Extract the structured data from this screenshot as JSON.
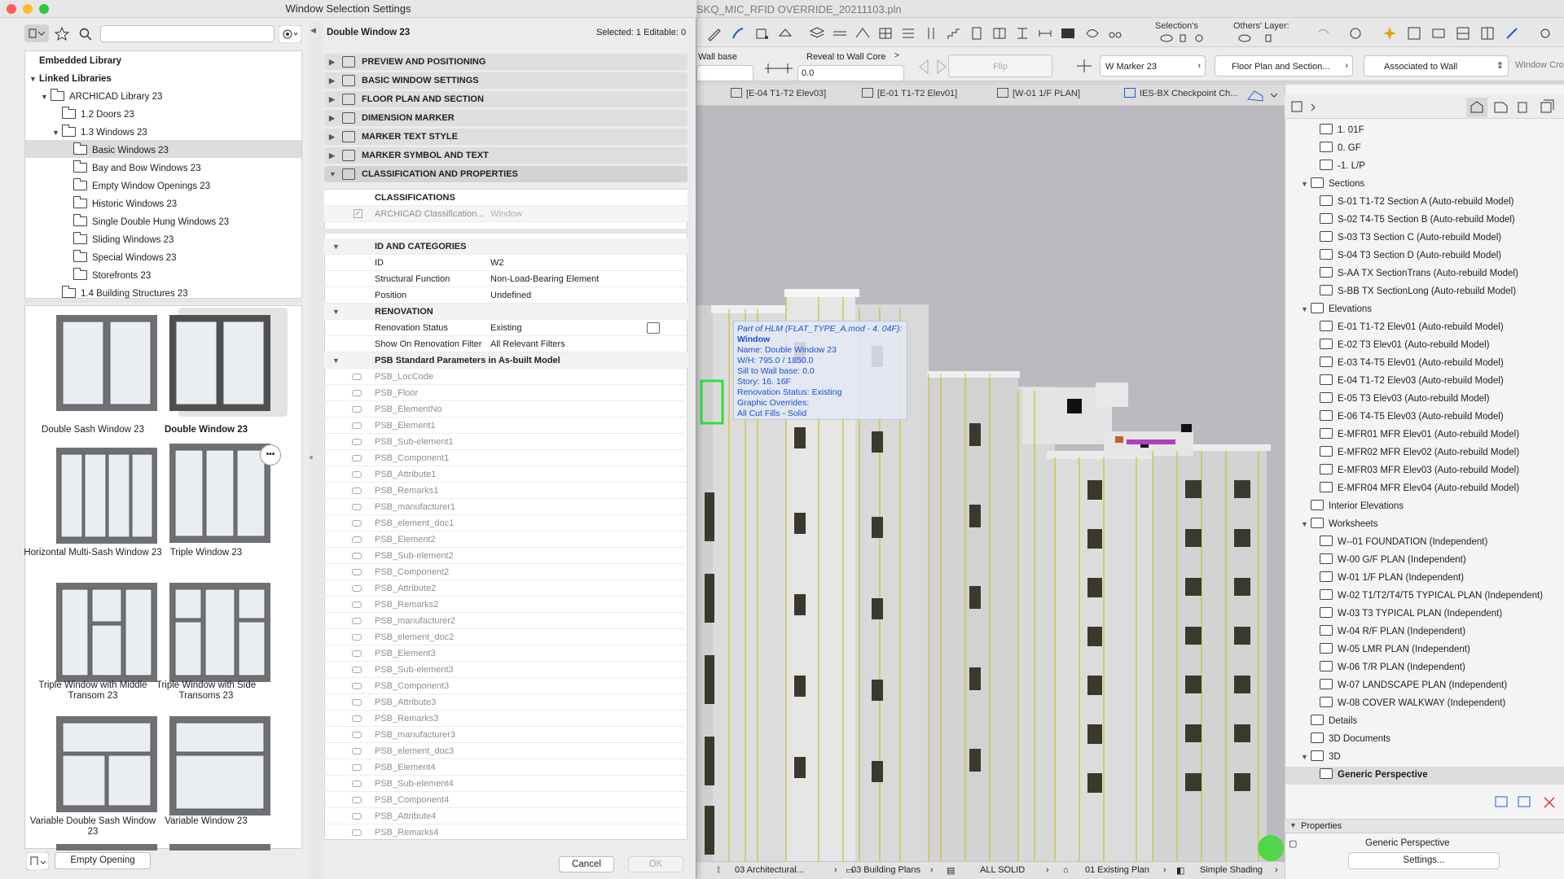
{
  "app": {
    "title": "SKQ_MIC_RFID OVERRIDE_20211103.pln",
    "selections_label": "Selection's",
    "others_layer_label": "Others' Layer:",
    "info": {
      "wall_base_label": "Wall base",
      "reveal_label": "Reveal to Wall Core",
      "reveal_value": "0.0",
      "flip_label": "Flip",
      "marker_value": "W Marker 23",
      "floorplan_value": "Floor Plan and Section...",
      "associated_value": "Associated to Wall",
      "window_cr_label": "Window Cro"
    },
    "tabs": [
      "[E-04 T1-T2 Elev03]",
      "[E-01 T1-T2 Elev01]",
      "[W-01 1/F PLAN]",
      "IES-BX Checkpoint Ch..."
    ],
    "status": {
      "layer_combo": "03 Architectural...",
      "model_view": "03 Building Plans",
      "pen_set": "ALL SOLID",
      "renovation": "01 Existing Plan",
      "shading": "Simple Shading"
    }
  },
  "tooltip": {
    "header": "Part of HLM (FLAT_TYPE_A.mod - 4. 04F):",
    "type": "Window",
    "lines": [
      "Name: Double Window 23",
      "W/H: 795.0 / 1850.0",
      "Sill to Wall base: 0.0",
      "Story: 16. 16F",
      "Renovation Status: Existing",
      "Graphic Overrides:",
      "All Cut Fills - Solid"
    ]
  },
  "navigator": {
    "rows": [
      {
        "label": "1. 01F",
        "level": 2
      },
      {
        "label": "0. GF",
        "level": 2
      },
      {
        "label": "-1. L/P",
        "level": 2
      },
      {
        "label": "Sections",
        "level": 1,
        "open": true
      },
      {
        "label": "S-01 T1-T2 Section A (Auto-rebuild Model)",
        "level": 2
      },
      {
        "label": "S-02 T4-T5 Section B (Auto-rebuild Model)",
        "level": 2
      },
      {
        "label": "S-03 T3 Section C (Auto-rebuild Model)",
        "level": 2
      },
      {
        "label": "S-04 T3 Section D (Auto-rebuild Model)",
        "level": 2
      },
      {
        "label": "S-AA TX SectionTrans (Auto-rebuild Model)",
        "level": 2
      },
      {
        "label": "S-BB TX SectionLong (Auto-rebuild Model)",
        "level": 2
      },
      {
        "label": "Elevations",
        "level": 1,
        "open": true
      },
      {
        "label": "E-01 T1-T2 Elev01 (Auto-rebuild Model)",
        "level": 2
      },
      {
        "label": "E-02 T3 Elev01 (Auto-rebuild Model)",
        "level": 2
      },
      {
        "label": "E-03 T4-T5 Elev01 (Auto-rebuild Model)",
        "level": 2
      },
      {
        "label": "E-04 T1-T2 Elev03 (Auto-rebuild Model)",
        "level": 2
      },
      {
        "label": "E-05 T3 Elev03 (Auto-rebuild Model)",
        "level": 2
      },
      {
        "label": "E-06 T4-T5 Elev03 (Auto-rebuild Model)",
        "level": 2
      },
      {
        "label": "E-MFR01 MFR Elev01 (Auto-rebuild Model)",
        "level": 2
      },
      {
        "label": "E-MFR02 MFR Elev02 (Auto-rebuild Model)",
        "level": 2
      },
      {
        "label": "E-MFR03 MFR Elev03 (Auto-rebuild Model)",
        "level": 2
      },
      {
        "label": "E-MFR04 MFR Elev04 (Auto-rebuild Model)",
        "level": 2
      },
      {
        "label": "Interior Elevations",
        "level": 1
      },
      {
        "label": "Worksheets",
        "level": 1,
        "open": true
      },
      {
        "label": "W--01 FOUNDATION (Independent)",
        "level": 2
      },
      {
        "label": "W-00 G/F PLAN (Independent)",
        "level": 2
      },
      {
        "label": "W-01 1/F PLAN (Independent)",
        "level": 2
      },
      {
        "label": "W-02 T1/T2/T4/T5 TYPICAL PLAN (Independent)",
        "level": 2
      },
      {
        "label": "W-03 T3 TYPICAL PLAN (Independent)",
        "level": 2
      },
      {
        "label": "W-04 R/F PLAN (Independent)",
        "level": 2
      },
      {
        "label": "W-05 LMR PLAN (Independent)",
        "level": 2
      },
      {
        "label": "W-06 T/R PLAN (Independent)",
        "level": 2
      },
      {
        "label": "W-07 LANDSCAPE PLAN (Independent)",
        "level": 2
      },
      {
        "label": "W-08 COVER WALKWAY (Independent)",
        "level": 2
      },
      {
        "label": "Details",
        "level": 1
      },
      {
        "label": "3D Documents",
        "level": 1
      },
      {
        "label": "3D",
        "level": 1,
        "open": true
      },
      {
        "label": "Generic Perspective",
        "level": 2,
        "selected": true
      }
    ],
    "properties_label": "Properties",
    "properties_value": "Generic Perspective",
    "settings_button": "Settings..."
  },
  "dialog": {
    "title": "Window Selection Settings",
    "tree": [
      {
        "label": "Embedded Library",
        "level": 0,
        "bold": true
      },
      {
        "label": "Linked Libraries",
        "level": 0,
        "bold": true,
        "open": true
      },
      {
        "label": "ARCHICAD Library 23",
        "level": 1,
        "open": true
      },
      {
        "label": "1.2 Doors 23",
        "level": 2
      },
      {
        "label": "1.3 Windows 23",
        "level": 2,
        "open": true
      },
      {
        "label": "Basic Windows 23",
        "level": 3,
        "selected": true
      },
      {
        "label": "Bay and Bow Windows 23",
        "level": 3
      },
      {
        "label": "Empty Window Openings 23",
        "level": 3
      },
      {
        "label": "Historic Windows 23",
        "level": 3
      },
      {
        "label": "Single Double Hung Windows 23",
        "level": 3
      },
      {
        "label": "Sliding Windows 23",
        "level": 3
      },
      {
        "label": "Special Windows 23",
        "level": 3
      },
      {
        "label": "Storefronts 23",
        "level": 3
      },
      {
        "label": "1.4 Building Structures 23",
        "level": 2
      }
    ],
    "windows": [
      {
        "label": "Double Sash Window 23",
        "kind": "double"
      },
      {
        "label": "Double Window 23",
        "kind": "double-dark",
        "selected": true
      },
      {
        "label": "Horizontal Multi-Sash Window 23",
        "kind": "multi"
      },
      {
        "label": "Triple Window 23",
        "kind": "triple"
      },
      {
        "label": "Triple Window with Middle Transom 23",
        "kind": "triple-mid"
      },
      {
        "label": "Triple Window with Side Transoms 23",
        "kind": "triple-side"
      },
      {
        "label": "Variable Double Sash Window 23",
        "kind": "variable-double"
      },
      {
        "label": "Variable Window 23",
        "kind": "variable"
      }
    ],
    "more_button": "•••",
    "empty_opening_button": "Empty Opening",
    "element_name": "Double Window 23",
    "selected_info": "Selected: 1 Editable: 0",
    "panels": [
      "PREVIEW AND POSITIONING",
      "BASIC WINDOW SETTINGS",
      "FLOOR PLAN AND SECTION",
      "DIMENSION MARKER",
      "MARKER TEXT STYLE",
      "MARKER SYMBOL AND TEXT",
      "CLASSIFICATION AND PROPERTIES"
    ],
    "classifications_title": "CLASSIFICATIONS",
    "classification_row": {
      "name": "ARCHICAD Classification...",
      "value": "Window"
    },
    "id_section": "ID AND CATEGORIES",
    "id_rows": [
      {
        "name": "ID",
        "value": "W2"
      },
      {
        "name": "Structural Function",
        "value": "Non-Load-Bearing Element"
      },
      {
        "name": "Position",
        "value": "Undefined"
      }
    ],
    "renovation_section": "RENOVATION",
    "renovation_rows": [
      {
        "name": "Renovation Status",
        "value": "Existing"
      },
      {
        "name": "Show On Renovation Filter",
        "value": "All Relevant Filters"
      }
    ],
    "psb_section": "PSB Standard Parameters in As-built Model",
    "psb_rows": [
      "PSB_LocCode",
      "PSB_Floor",
      "PSB_ElementNo",
      "PSB_Element1",
      "PSB_Sub-element1",
      "PSB_Component1",
      "PSB_Attribute1",
      "PSB_Remarks1",
      "PSB_manufacturer1",
      "PSB_element_doc1",
      "PSB_Element2",
      "PSB_Sub-element2",
      "PSB_Component2",
      "PSB_Attribute2",
      "PSB_Remarks2",
      "PSB_manufacturer2",
      "PSB_element_doc2",
      "PSB_Element3",
      "PSB_Sub-element3",
      "PSB_Component3",
      "PSB_Attribute3",
      "PSB_Remarks3",
      "PSB_manufacturer3",
      "PSB_element_doc3",
      "PSB_Element4",
      "PSB_Sub-element4",
      "PSB_Component4",
      "PSB_Attribute4",
      "PSB_Remarks4"
    ],
    "cancel_button": "Cancel",
    "ok_button": "OK"
  },
  "colors": {
    "accent_blue": "#1d4ed8",
    "close_red": "#ff5f57",
    "minimize_yellow": "#febc2e",
    "maximize_green": "#28c840",
    "frame_yellow": "#c8c22a",
    "selection_green": "#2ee03a"
  }
}
